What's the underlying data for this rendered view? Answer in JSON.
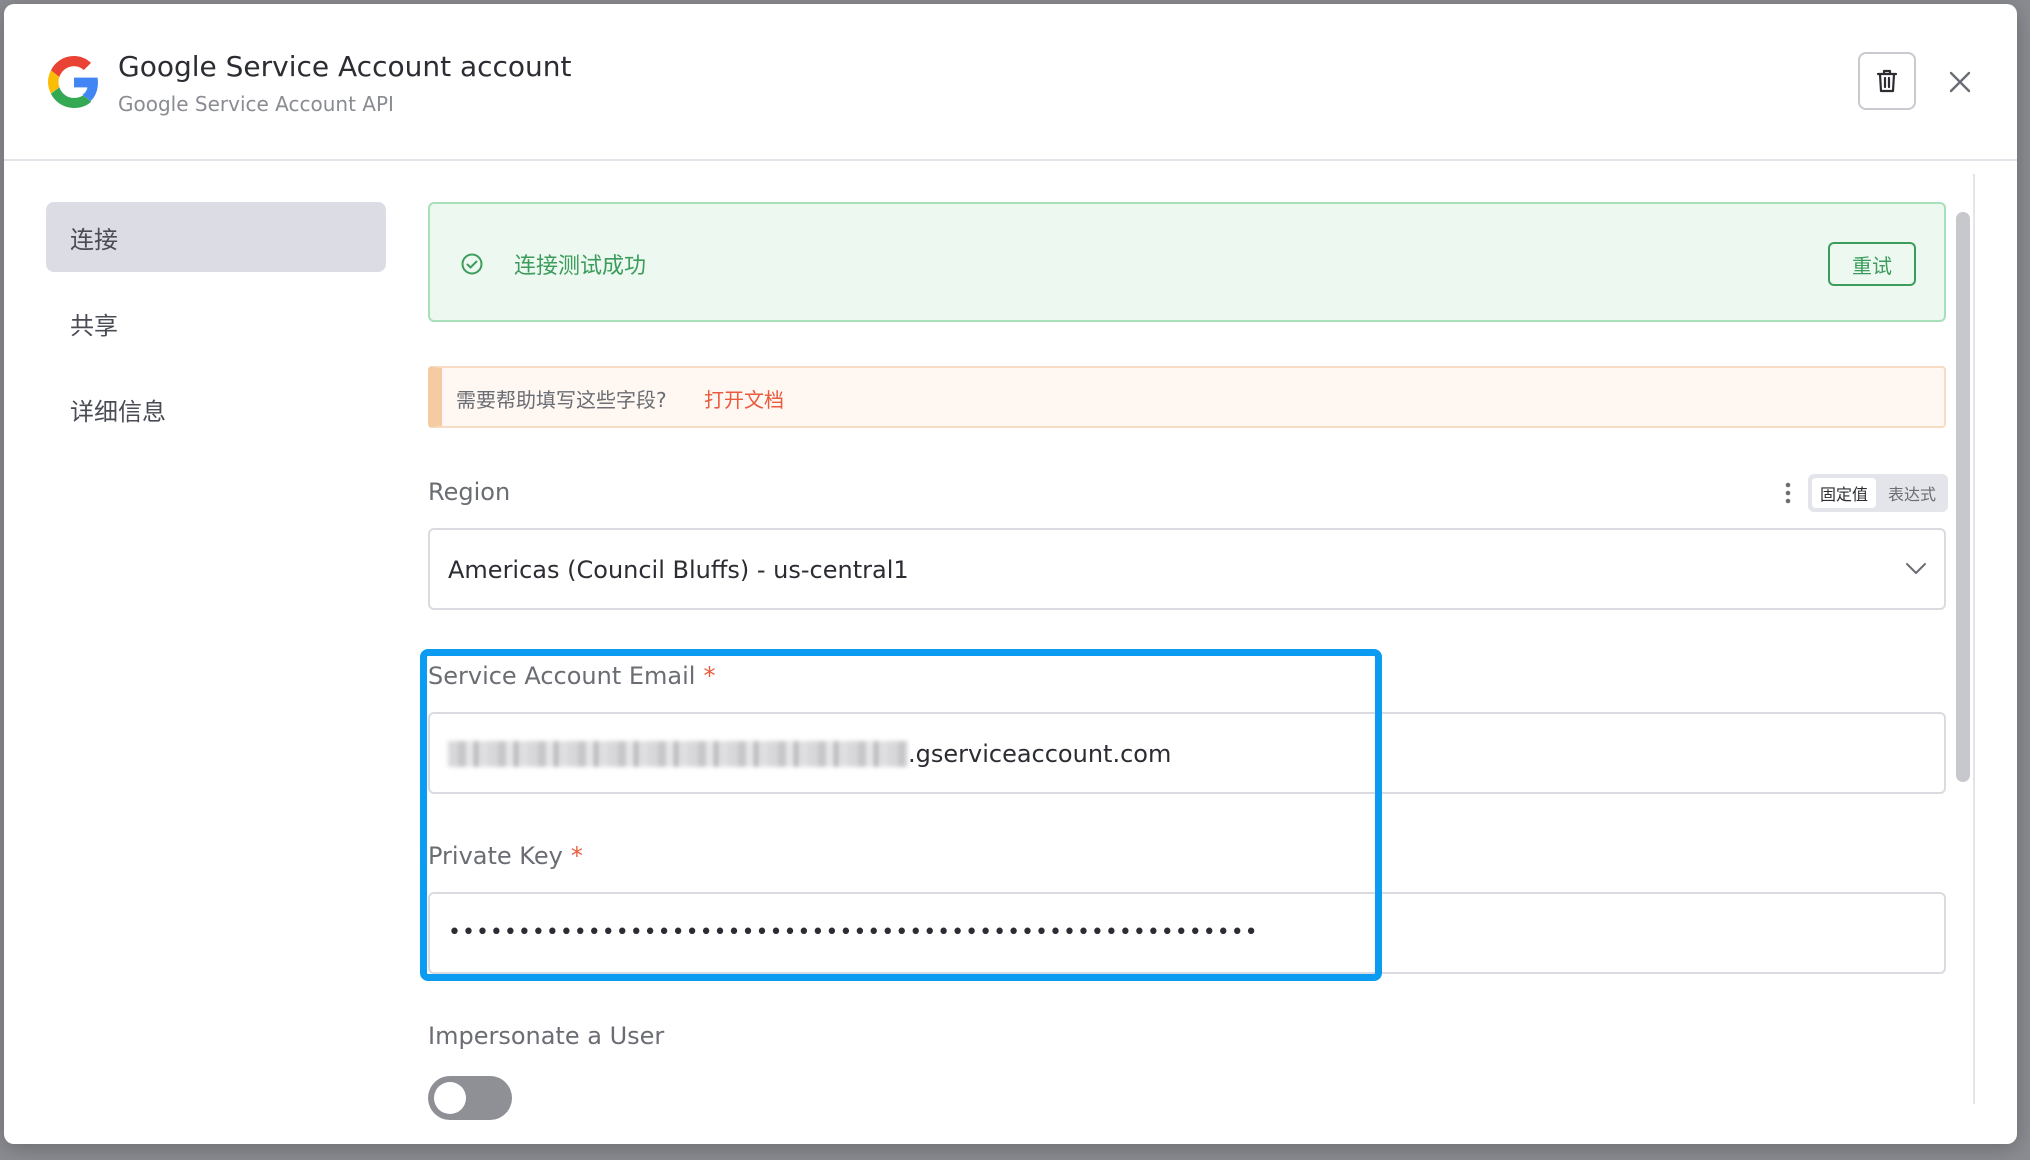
{
  "dialog": {
    "title": "Google Service Account account",
    "subtitle": "Google Service Account API"
  },
  "sidebar": {
    "items": [
      {
        "label": "连接",
        "active": true
      },
      {
        "label": "共享",
        "active": false
      },
      {
        "label": "详细信息",
        "active": false
      }
    ]
  },
  "status": {
    "message": "连接测试成功",
    "retry_label": "重试"
  },
  "help": {
    "text": "需要帮助填写这些字段?",
    "link": "打开文档"
  },
  "region": {
    "label": "Region",
    "value": "Americas (Council Bluffs) - us-central1",
    "mode_fixed": "固定值",
    "mode_expression": "表达式"
  },
  "email": {
    "label": "Service Account Email",
    "required": "*",
    "value_suffix": ".gserviceaccount.com"
  },
  "private_key": {
    "label": "Private Key",
    "required": "*",
    "value": "••••••••••••••••••••••••••••••••••••••••••••••••••••••••••"
  },
  "impersonate": {
    "label": "Impersonate a User",
    "enabled": false
  },
  "colors": {
    "success": "#3c9c5c",
    "link": "#ea5a3d",
    "highlight": "#0b9cf2"
  },
  "icons": [
    "google-logo",
    "trash-icon",
    "close-icon",
    "check-circle-icon",
    "kebab-menu-icon",
    "chevron-down-icon"
  ]
}
